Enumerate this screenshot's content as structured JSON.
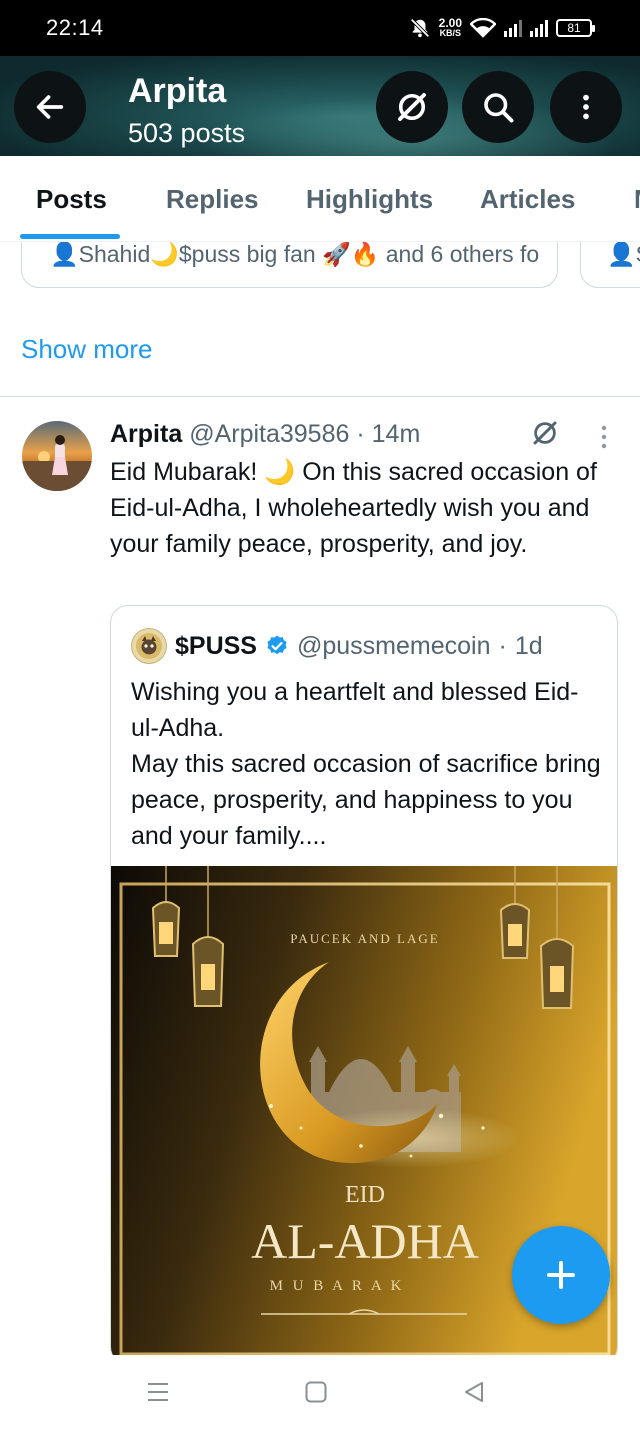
{
  "status_bar": {
    "time": "22:14",
    "speed_value": "2.00",
    "speed_unit": "KB/S",
    "battery": "81"
  },
  "header": {
    "title": "Arpita",
    "posts_count": "503 posts"
  },
  "tabs": [
    {
      "label": "Posts",
      "active": true
    },
    {
      "label": "Replies"
    },
    {
      "label": "Highlights"
    },
    {
      "label": "Articles"
    },
    {
      "label": "M"
    }
  ],
  "recommend_cards": [
    {
      "text": "👤Shahid🌙$puss big fan 🚀🔥 and 6 others fo"
    },
    {
      "text": "👤S"
    }
  ],
  "show_more": "Show more",
  "post": {
    "author_name": "Arpita",
    "author_handle": "@Arpita39586",
    "separator": "·",
    "time": "14m",
    "text": "Eid Mubarak! 🌙 On this sacred occasion of Eid-ul-Adha, I wholeheartedly wish you and your family peace, prosperity, and joy."
  },
  "quote": {
    "name": "$PUSS",
    "verified": true,
    "handle": "@pussmemecoin",
    "separator": "·",
    "time": "1d",
    "text_line1": "Wishing you a heartfelt and blessed Eid-ul-Adha.",
    "text_line2": "May this sacred occasion of sacrifice bring peace, prosperity, and happiness to you and your family....",
    "image": {
      "top_text": "PAUCEK AND LAGE",
      "eid": "EID",
      "al_adha": "AL-ADHA",
      "mubarak": "M U B A R A K"
    }
  },
  "icons": {
    "back": "arrow-left-icon",
    "grok": "grok-icon",
    "search": "search-icon",
    "more": "more-vertical-icon",
    "fab": "plus-icon",
    "verified": "verified-badge-icon"
  },
  "colors": {
    "accent": "#1d9bf0",
    "text": "#0f1419",
    "secondary": "#536471",
    "gold": "#d4a531"
  }
}
